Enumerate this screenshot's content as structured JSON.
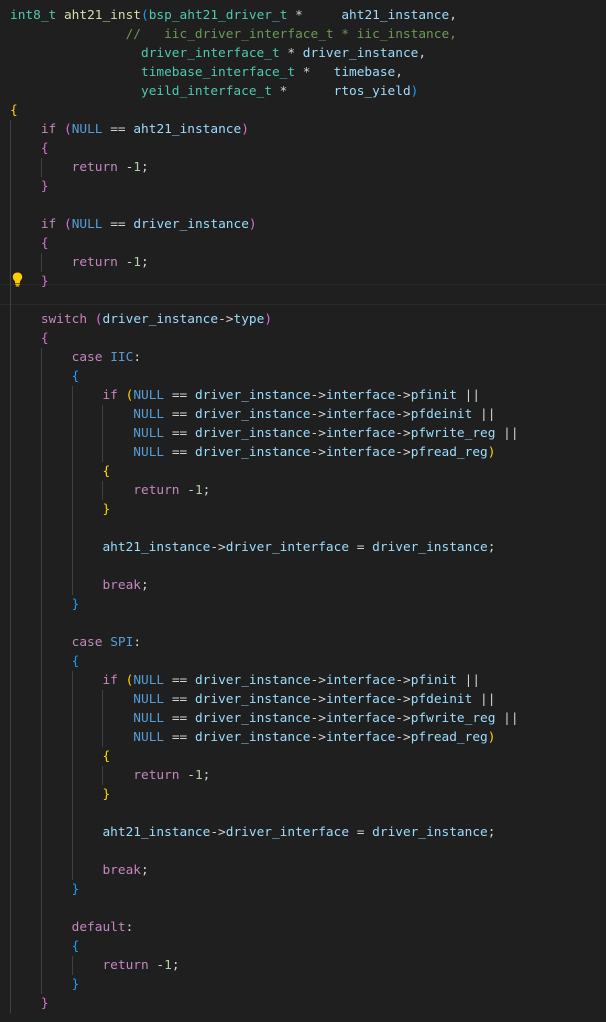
{
  "colors": {
    "background": "#1f1f1f",
    "default": "#d4d4d4",
    "type": "#4ec9b0",
    "function": "#dcdcaa",
    "keyword": "#c586c0",
    "variable": "#9cdcfe",
    "constant": "#569cd6",
    "number": "#b5cea8",
    "comment": "#6a9955",
    "bracket1": "#ffd700",
    "bracket2": "#da70d6",
    "bracket3": "#179fff"
  },
  "icons": {
    "lightbulb": "lightbulb-icon"
  },
  "code_lines": [
    [
      [
        "t",
        "int8_t"
      ],
      [
        "d",
        " "
      ],
      [
        "f",
        "aht21_inst"
      ],
      [
        "b3",
        "("
      ],
      [
        "t",
        "bsp_aht21_driver_t"
      ],
      [
        "d",
        " *     "
      ],
      [
        "v",
        "aht21_instance"
      ],
      [
        "d",
        ","
      ]
    ],
    [
      [
        "d",
        "               "
      ],
      [
        "c",
        "//   iic_driver_interface_t * iic_instance,"
      ]
    ],
    [
      [
        "d",
        "                 "
      ],
      [
        "t",
        "driver_interface_t"
      ],
      [
        "d",
        " * "
      ],
      [
        "v",
        "driver_instance"
      ],
      [
        "d",
        ","
      ]
    ],
    [
      [
        "d",
        "                 "
      ],
      [
        "t",
        "timebase_interface_t"
      ],
      [
        "d",
        " *   "
      ],
      [
        "v",
        "timebase"
      ],
      [
        "d",
        ","
      ]
    ],
    [
      [
        "d",
        "                 "
      ],
      [
        "t",
        "yeild_interface_t"
      ],
      [
        "d",
        " *      "
      ],
      [
        "v",
        "rtos_yield"
      ],
      [
        "b3",
        ")"
      ]
    ],
    [
      [
        "b1",
        "{"
      ]
    ],
    [
      [
        "d",
        "    "
      ],
      [
        "k",
        "if"
      ],
      [
        "d",
        " "
      ],
      [
        "b2",
        "("
      ],
      [
        "n",
        "NULL"
      ],
      [
        "d",
        " == "
      ],
      [
        "v",
        "aht21_instance"
      ],
      [
        "b2",
        ")"
      ]
    ],
    [
      [
        "d",
        "    "
      ],
      [
        "b2",
        "{"
      ]
    ],
    [
      [
        "d",
        "        "
      ],
      [
        "k",
        "return"
      ],
      [
        "d",
        " -"
      ],
      [
        "num",
        "1"
      ],
      [
        "d",
        ";"
      ]
    ],
    [
      [
        "d",
        "    "
      ],
      [
        "b2",
        "}"
      ]
    ],
    [],
    [
      [
        "d",
        "    "
      ],
      [
        "k",
        "if"
      ],
      [
        "d",
        " "
      ],
      [
        "b2",
        "("
      ],
      [
        "n",
        "NULL"
      ],
      [
        "d",
        " == "
      ],
      [
        "v",
        "driver_instance"
      ],
      [
        "b2",
        ")"
      ]
    ],
    [
      [
        "d",
        "    "
      ],
      [
        "b2",
        "{"
      ]
    ],
    [
      [
        "d",
        "        "
      ],
      [
        "k",
        "return"
      ],
      [
        "d",
        " -"
      ],
      [
        "num",
        "1"
      ],
      [
        "d",
        ";"
      ]
    ],
    [
      [
        "d",
        "    "
      ],
      [
        "b2",
        "}"
      ]
    ],
    [],
    [
      [
        "d",
        "    "
      ],
      [
        "k",
        "switch"
      ],
      [
        "d",
        " "
      ],
      [
        "b2",
        "("
      ],
      [
        "v",
        "driver_instance"
      ],
      [
        "d",
        "->"
      ],
      [
        "v",
        "type"
      ],
      [
        "b2",
        ")"
      ]
    ],
    [
      [
        "d",
        "    "
      ],
      [
        "b2",
        "{"
      ]
    ],
    [
      [
        "d",
        "        "
      ],
      [
        "k",
        "case"
      ],
      [
        "d",
        " "
      ],
      [
        "n",
        "IIC"
      ],
      [
        "d",
        ":"
      ]
    ],
    [
      [
        "d",
        "        "
      ],
      [
        "b3",
        "{"
      ]
    ],
    [
      [
        "d",
        "            "
      ],
      [
        "k",
        "if"
      ],
      [
        "d",
        " "
      ],
      [
        "b1",
        "("
      ],
      [
        "n",
        "NULL"
      ],
      [
        "d",
        " == "
      ],
      [
        "v",
        "driver_instance"
      ],
      [
        "d",
        "->"
      ],
      [
        "v",
        "interface"
      ],
      [
        "d",
        "->"
      ],
      [
        "v",
        "pfinit"
      ],
      [
        "d",
        " ||"
      ]
    ],
    [
      [
        "d",
        "                "
      ],
      [
        "n",
        "NULL"
      ],
      [
        "d",
        " == "
      ],
      [
        "v",
        "driver_instance"
      ],
      [
        "d",
        "->"
      ],
      [
        "v",
        "interface"
      ],
      [
        "d",
        "->"
      ],
      [
        "v",
        "pfdeinit"
      ],
      [
        "d",
        " ||"
      ]
    ],
    [
      [
        "d",
        "                "
      ],
      [
        "n",
        "NULL"
      ],
      [
        "d",
        " == "
      ],
      [
        "v",
        "driver_instance"
      ],
      [
        "d",
        "->"
      ],
      [
        "v",
        "interface"
      ],
      [
        "d",
        "->"
      ],
      [
        "v",
        "pfwrite_reg"
      ],
      [
        "d",
        " ||"
      ]
    ],
    [
      [
        "d",
        "                "
      ],
      [
        "n",
        "NULL"
      ],
      [
        "d",
        " == "
      ],
      [
        "v",
        "driver_instance"
      ],
      [
        "d",
        "->"
      ],
      [
        "v",
        "interface"
      ],
      [
        "d",
        "->"
      ],
      [
        "v",
        "pfread_reg"
      ],
      [
        "b1",
        ")"
      ]
    ],
    [
      [
        "d",
        "            "
      ],
      [
        "b1",
        "{"
      ]
    ],
    [
      [
        "d",
        "                "
      ],
      [
        "k",
        "return"
      ],
      [
        "d",
        " -"
      ],
      [
        "num",
        "1"
      ],
      [
        "d",
        ";"
      ]
    ],
    [
      [
        "d",
        "            "
      ],
      [
        "b1",
        "}"
      ]
    ],
    [],
    [
      [
        "d",
        "            "
      ],
      [
        "v",
        "aht21_instance"
      ],
      [
        "d",
        "->"
      ],
      [
        "v",
        "driver_interface"
      ],
      [
        "d",
        " = "
      ],
      [
        "v",
        "driver_instance"
      ],
      [
        "d",
        ";"
      ]
    ],
    [],
    [
      [
        "d",
        "            "
      ],
      [
        "k",
        "break"
      ],
      [
        "d",
        ";"
      ]
    ],
    [
      [
        "d",
        "        "
      ],
      [
        "b3",
        "}"
      ]
    ],
    [],
    [
      [
        "d",
        "        "
      ],
      [
        "k",
        "case"
      ],
      [
        "d",
        " "
      ],
      [
        "n",
        "SPI"
      ],
      [
        "d",
        ":"
      ]
    ],
    [
      [
        "d",
        "        "
      ],
      [
        "b3",
        "{"
      ]
    ],
    [
      [
        "d",
        "            "
      ],
      [
        "k",
        "if"
      ],
      [
        "d",
        " "
      ],
      [
        "b1",
        "("
      ],
      [
        "n",
        "NULL"
      ],
      [
        "d",
        " == "
      ],
      [
        "v",
        "driver_instance"
      ],
      [
        "d",
        "->"
      ],
      [
        "v",
        "interface"
      ],
      [
        "d",
        "->"
      ],
      [
        "v",
        "pfinit"
      ],
      [
        "d",
        " ||"
      ]
    ],
    [
      [
        "d",
        "                "
      ],
      [
        "n",
        "NULL"
      ],
      [
        "d",
        " == "
      ],
      [
        "v",
        "driver_instance"
      ],
      [
        "d",
        "->"
      ],
      [
        "v",
        "interface"
      ],
      [
        "d",
        "->"
      ],
      [
        "v",
        "pfdeinit"
      ],
      [
        "d",
        " ||"
      ]
    ],
    [
      [
        "d",
        "                "
      ],
      [
        "n",
        "NULL"
      ],
      [
        "d",
        " == "
      ],
      [
        "v",
        "driver_instance"
      ],
      [
        "d",
        "->"
      ],
      [
        "v",
        "interface"
      ],
      [
        "d",
        "->"
      ],
      [
        "v",
        "pfwrite_reg"
      ],
      [
        "d",
        " ||"
      ]
    ],
    [
      [
        "d",
        "                "
      ],
      [
        "n",
        "NULL"
      ],
      [
        "d",
        " == "
      ],
      [
        "v",
        "driver_instance"
      ],
      [
        "d",
        "->"
      ],
      [
        "v",
        "interface"
      ],
      [
        "d",
        "->"
      ],
      [
        "v",
        "pfread_reg"
      ],
      [
        "b1",
        ")"
      ]
    ],
    [
      [
        "d",
        "            "
      ],
      [
        "b1",
        "{"
      ]
    ],
    [
      [
        "d",
        "                "
      ],
      [
        "k",
        "return"
      ],
      [
        "d",
        " -"
      ],
      [
        "num",
        "1"
      ],
      [
        "d",
        ";"
      ]
    ],
    [
      [
        "d",
        "            "
      ],
      [
        "b1",
        "}"
      ]
    ],
    [],
    [
      [
        "d",
        "            "
      ],
      [
        "v",
        "aht21_instance"
      ],
      [
        "d",
        "->"
      ],
      [
        "v",
        "driver_interface"
      ],
      [
        "d",
        " = "
      ],
      [
        "v",
        "driver_instance"
      ],
      [
        "d",
        ";"
      ]
    ],
    [],
    [
      [
        "d",
        "            "
      ],
      [
        "k",
        "break"
      ],
      [
        "d",
        ";"
      ]
    ],
    [
      [
        "d",
        "        "
      ],
      [
        "b3",
        "}"
      ]
    ],
    [],
    [
      [
        "d",
        "        "
      ],
      [
        "k",
        "default"
      ],
      [
        "d",
        ":"
      ]
    ],
    [
      [
        "d",
        "        "
      ],
      [
        "b3",
        "{"
      ]
    ],
    [
      [
        "d",
        "            "
      ],
      [
        "k",
        "return"
      ],
      [
        "d",
        " -"
      ],
      [
        "num",
        "1"
      ],
      [
        "d",
        ";"
      ]
    ],
    [
      [
        "d",
        "        "
      ],
      [
        "b3",
        "}"
      ]
    ],
    [
      [
        "d",
        "    "
      ],
      [
        "b2",
        "}"
      ]
    ]
  ]
}
